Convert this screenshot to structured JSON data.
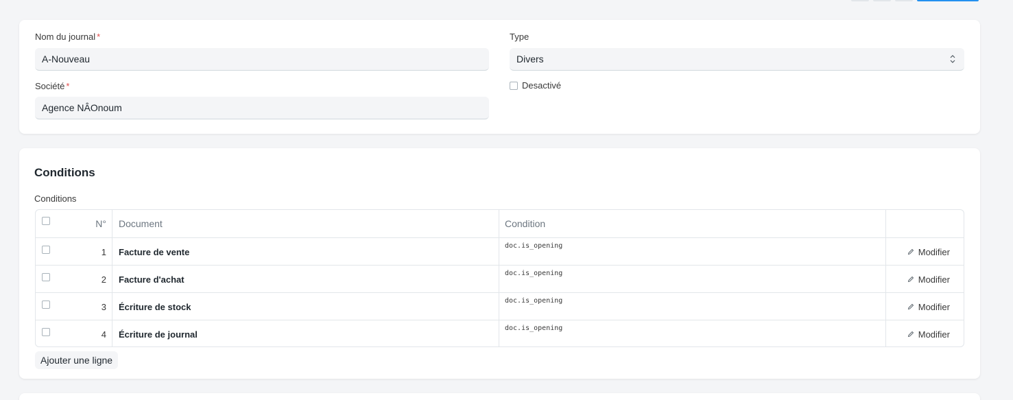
{
  "form": {
    "journal_name_label": "Nom du journal",
    "journal_name_required": "*",
    "journal_name_value": "A-Nouveau",
    "company_label": "Société",
    "company_required": "*",
    "company_value": "Agence NÂOnoum",
    "type_label": "Type",
    "type_value": "Divers",
    "disabled_label": "Desactivé"
  },
  "conditions": {
    "section_title": "Conditions",
    "table_label": "Conditions",
    "columns": {
      "no": "N°",
      "document": "Document",
      "condition": "Condition"
    },
    "rows": [
      {
        "no": "1",
        "document": "Facture de vente",
        "condition": "doc.is_opening",
        "action": "Modifier"
      },
      {
        "no": "2",
        "document": "Facture d'achat",
        "condition": "doc.is_opening",
        "action": "Modifier"
      },
      {
        "no": "3",
        "document": "Écriture de stock",
        "condition": "doc.is_opening",
        "action": "Modifier"
      },
      {
        "no": "4",
        "document": "Écriture de journal",
        "condition": "doc.is_opening",
        "action": "Modifier"
      }
    ],
    "add_row_label": "Ajouter une ligne"
  },
  "icons": {
    "edit": "pencil-icon",
    "select": "chevron-updown-icon"
  },
  "colors": {
    "background": "#f4f5f7",
    "card": "#ffffff",
    "required": "#e24c4c",
    "primary": "#2490ef"
  }
}
